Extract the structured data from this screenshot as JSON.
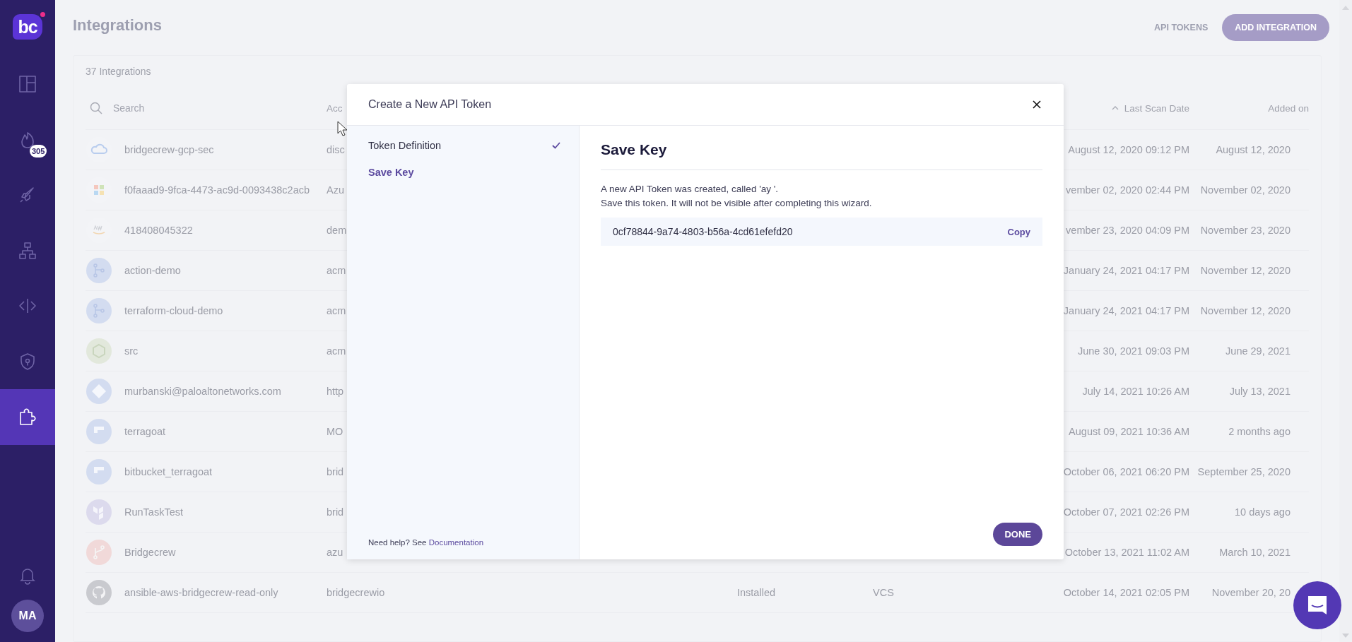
{
  "sidebar": {
    "logo_text": "bc",
    "items": [
      {
        "kind": "dashboard",
        "selected": false
      },
      {
        "kind": "flame",
        "selected": false,
        "badge": "305"
      },
      {
        "kind": "rocket",
        "selected": false
      },
      {
        "kind": "hierarchy",
        "selected": false
      },
      {
        "kind": "code",
        "selected": false
      },
      {
        "kind": "shield",
        "selected": false
      },
      {
        "kind": "puzzle",
        "selected": true
      }
    ],
    "bottom": {
      "kind": "bell"
    },
    "avatar": "MA"
  },
  "page": {
    "title": "Integrations",
    "api_tokens": "API TOKENS",
    "add_button": "ADD INTEGRATION"
  },
  "table": {
    "count": "37 Integrations",
    "search": {
      "placeholder": "Search"
    },
    "columns": {
      "account": "Acc",
      "last_scan": "Last Scan Date",
      "added": "Added on"
    },
    "rows": [
      {
        "kind": "cloud",
        "name": "bridgecrew-gcp-sec",
        "account": "disc",
        "last_scan": "August 12, 2020 09:12 PM",
        "added": "August 12, 2020"
      },
      {
        "kind": "grid",
        "name": "f0faaad9-9fca-4473-ac9d-0093438c2acb",
        "account": "Azu",
        "last_scan": "vember 02, 2020 02:44 PM",
        "added": "November 02, 2020"
      },
      {
        "kind": "aws",
        "name": "418408045322",
        "account": "dem",
        "last_scan": "vember 23, 2020 04:09 PM",
        "added": "November 23, 2020"
      },
      {
        "kind": "pipeline",
        "name": "action-demo",
        "account": "acm",
        "last_scan": "January 24, 2021 04:17 PM",
        "added": "November 12, 2020"
      },
      {
        "kind": "pipeline",
        "name": "terraform-cloud-demo",
        "account": "acm",
        "last_scan": "January 24, 2021 04:17 PM",
        "added": "November 12, 2020"
      },
      {
        "kind": "cube",
        "name": "src",
        "account": "acm",
        "last_scan": "June 30, 2021 09:03 PM",
        "added": "June 29, 2021"
      },
      {
        "kind": "diamond",
        "name": "murbanski@paloaltonetworks.com",
        "account": "http",
        "last_scan": "July 14, 2021 10:26 AM",
        "added": "July 13, 2021"
      },
      {
        "kind": "flag",
        "name": "terragoat",
        "account": "MO",
        "last_scan": "August 09, 2021 10:36 AM",
        "added": "2 months ago"
      },
      {
        "kind": "flag",
        "name": "bitbucket_terragoat",
        "account": "brid",
        "last_scan": "October 06, 2021 06:20 PM",
        "added": "September 25, 2020"
      },
      {
        "kind": "terraform",
        "name": "RunTaskTest",
        "account": "brid",
        "last_scan": "October 07, 2021 02:26 PM",
        "added": "10 days ago"
      },
      {
        "kind": "branch",
        "name": "Bridgecrew",
        "account": "azu",
        "last_scan": "October 13, 2021 11:02 AM",
        "added": "March 10, 2021"
      },
      {
        "kind": "github",
        "name": "ansible-aws-bridgecrew-read-only",
        "account": "bridgecrewio",
        "status": "Installed",
        "type": "VCS",
        "last_scan": "October 14, 2021 02:05 PM",
        "added": "November 20, 20"
      }
    ]
  },
  "modal": {
    "title": "Create a New API Token",
    "steps": [
      {
        "label": "Token Definition",
        "done": true,
        "selected": false
      },
      {
        "label": "Save Key",
        "done": false,
        "selected": true
      }
    ],
    "help": {
      "text": "Need help? See",
      "link": "Documentation"
    },
    "heading": "Save Key",
    "message": [
      "A new API Token was created, called 'ay '.",
      "Save this token. It will not be visible after completing this wizard."
    ],
    "token": "0cf78844-9a74-4803-b56a-4cd61efefd20",
    "copy": "Copy",
    "done_button": "DONE"
  }
}
